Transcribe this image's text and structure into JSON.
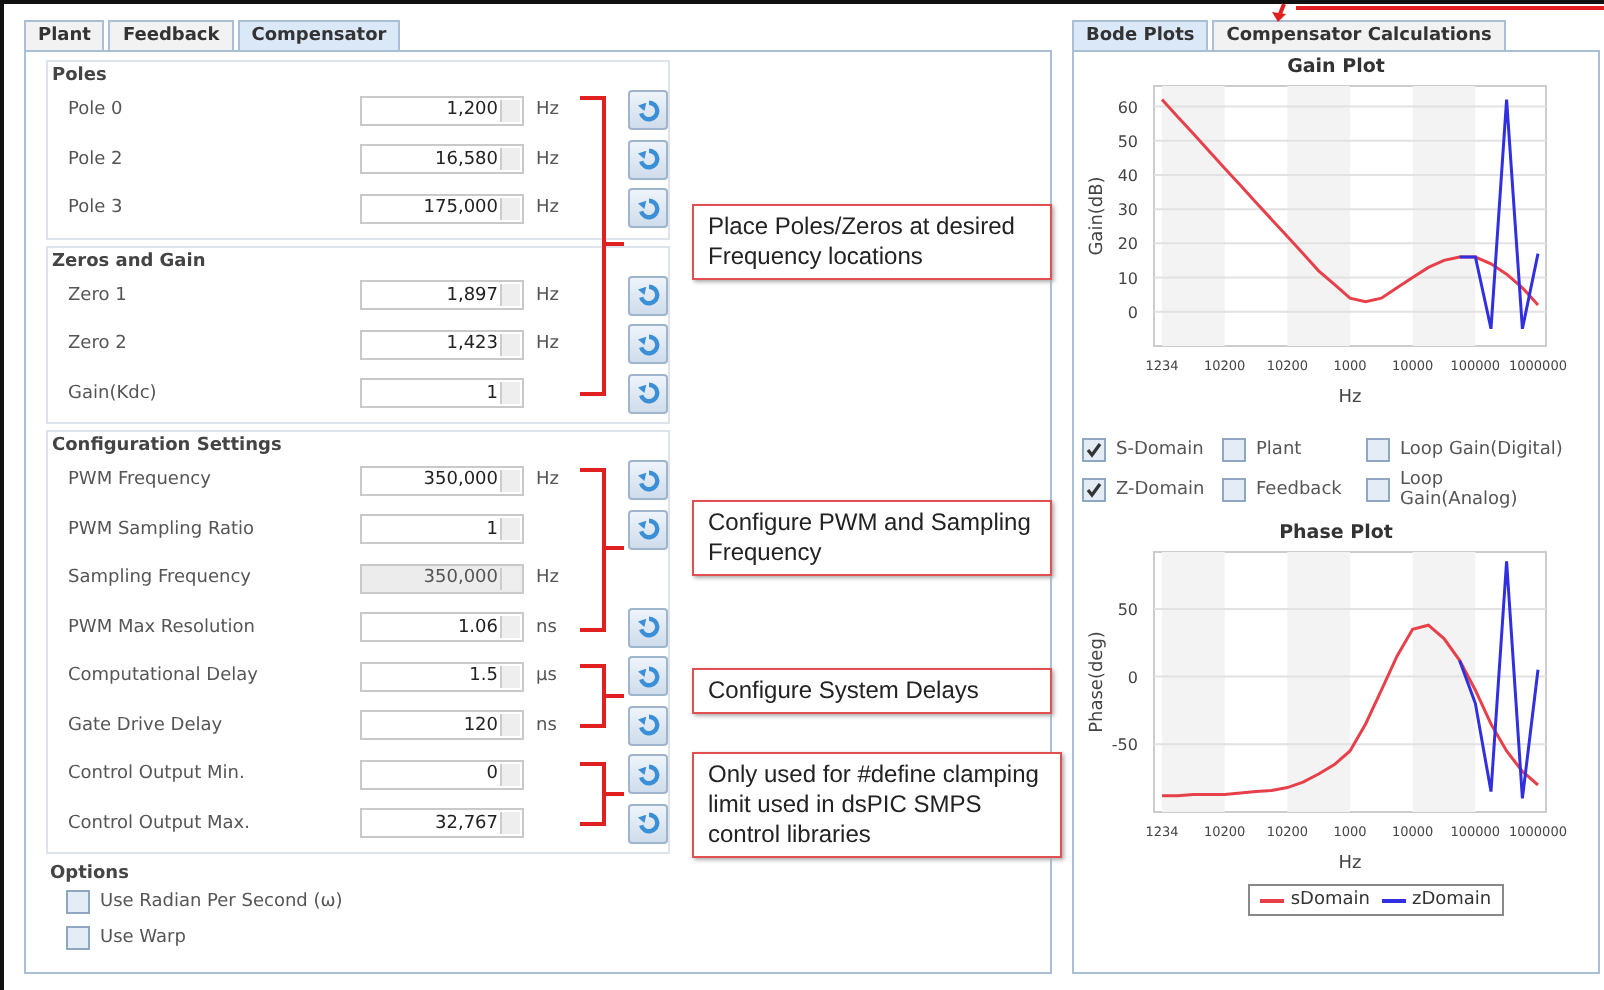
{
  "left_tabs": [
    {
      "label": "Plant",
      "selected": false
    },
    {
      "label": "Feedback",
      "selected": false
    },
    {
      "label": "Compensator",
      "selected": true
    }
  ],
  "groups": [
    {
      "title": "Poles",
      "rows": [
        {
          "label": "Pole 0",
          "value": "1,200",
          "unit": "Hz",
          "disabled": false,
          "reset_button": true
        },
        {
          "label": "Pole 2",
          "value": "16,580",
          "unit": "Hz",
          "disabled": false,
          "reset_button": true
        },
        {
          "label": "Pole 3",
          "value": "175,000",
          "unit": "Hz",
          "disabled": false,
          "reset_button": true
        }
      ]
    },
    {
      "title": "Zeros and Gain",
      "rows": [
        {
          "label": "Zero 1",
          "value": "1,897",
          "unit": "Hz",
          "disabled": false,
          "reset_button": true
        },
        {
          "label": "Zero 2",
          "value": "1,423",
          "unit": "Hz",
          "disabled": false,
          "reset_button": true
        },
        {
          "label": "Gain(Kdc)",
          "value": "1",
          "disabled": false,
          "reset_button": true
        }
      ]
    },
    {
      "title": "Configuration Settings",
      "rows": [
        {
          "label": "PWM Frequency",
          "value": "350,000",
          "unit": "Hz",
          "disabled": false,
          "reset_button": true
        },
        {
          "label": "PWM Sampling Ratio",
          "value": "1",
          "disabled": false,
          "reset_button": true
        },
        {
          "label": "Sampling Frequency",
          "value": "350,000",
          "unit": "Hz",
          "disabled": true,
          "reset_button": false
        },
        {
          "label": "PWM Max Resolution",
          "value": "1.06",
          "unit": "ns",
          "disabled": false,
          "reset_button": true
        },
        {
          "label": "Computational Delay",
          "value": "1.5",
          "unit": "µs",
          "disabled": false,
          "reset_button": true
        },
        {
          "label": "Gate Drive Delay",
          "value": "120",
          "unit": "ns",
          "disabled": false,
          "reset_button": true
        },
        {
          "label": "Control Output Min.",
          "value": "0",
          "disabled": false,
          "reset_button": true
        },
        {
          "label": "Control Output Max.",
          "value": "32,767",
          "disabled": false,
          "reset_button": true
        }
      ]
    }
  ],
  "options": {
    "title": "Options",
    "items": [
      {
        "label": "Use Radian Per Second (ω)",
        "checked": false
      },
      {
        "label": "Use Warp",
        "checked": false
      }
    ]
  },
  "callouts": [
    "Place Poles/Zeros at desired Frequency locations",
    "Configure PWM and Sampling Frequency",
    "Configure System Delays",
    "Only used for #define clamping limit used in dsPIC SMPS control libraries"
  ],
  "right_tabs": [
    {
      "label": "Bode Plots",
      "selected": true
    },
    {
      "label": "Compensator Calculations",
      "selected": false
    }
  ],
  "gain_plot": {
    "chart_data": {
      "type": "line",
      "title": "Gain Plot",
      "xlabel": "Hz",
      "ylabel": "Gain(dB)",
      "categories": [
        "1234",
        null,
        null,
        null,
        "10200",
        null,
        null,
        null,
        "10200",
        null,
        null,
        null,
        "1000",
        null,
        null,
        null,
        "10000",
        null,
        null,
        null,
        "100000",
        null,
        null,
        null,
        "1000000"
      ],
      "series": [
        {
          "color": "#e8404a",
          "values": [
            62,
            57,
            52,
            47,
            42,
            37,
            32,
            27,
            22,
            17,
            12,
            8,
            4,
            3,
            4,
            7,
            10,
            13,
            15,
            16,
            16,
            14,
            11,
            7,
            2
          ]
        },
        {
          "color": "#3030e0",
          "values": [
            null,
            null,
            null,
            null,
            null,
            null,
            null,
            null,
            null,
            null,
            null,
            null,
            null,
            null,
            null,
            null,
            null,
            null,
            null,
            16,
            16,
            -5,
            62,
            -5,
            17
          ]
        }
      ],
      "grid": true,
      "ylim": [
        -10,
        66
      ],
      "yticks": [
        0,
        10,
        20,
        30,
        40,
        50,
        60
      ]
    }
  },
  "series_toggles": [
    {
      "label": "S-Domain",
      "checked": true
    },
    {
      "label": "Plant",
      "checked": false
    },
    {
      "label": "Loop Gain(Digital)",
      "checked": false
    },
    {
      "label": "Z-Domain",
      "checked": true
    },
    {
      "label": "Feedback",
      "checked": false
    },
    {
      "label": "Loop Gain(Analog)",
      "checked": false
    }
  ],
  "phase_plot": {
    "chart_data": {
      "type": "line",
      "title": "Phase Plot",
      "xlabel": "Hz",
      "ylabel": "Phase(deg)",
      "categories": [
        "1234",
        null,
        null,
        null,
        "10200",
        null,
        null,
        null,
        "10200",
        null,
        null,
        null,
        "1000",
        null,
        null,
        null,
        "10000",
        null,
        null,
        null,
        "100000",
        null,
        null,
        null,
        "1000000"
      ],
      "series": [
        {
          "name": "sDomain",
          "color": "#e8404a",
          "values": [
            -88,
            -88,
            -87,
            -87,
            -87,
            -86,
            -85,
            -84,
            -82,
            -78,
            -72,
            -65,
            -55,
            -35,
            -10,
            15,
            35,
            38,
            28,
            12,
            -10,
            -35,
            -55,
            -70,
            -80
          ]
        },
        {
          "name": "zDomain",
          "color": "#3030e0",
          "values": [
            null,
            null,
            null,
            null,
            null,
            null,
            null,
            null,
            null,
            null,
            null,
            null,
            null,
            null,
            null,
            null,
            null,
            null,
            null,
            12,
            -20,
            -85,
            85,
            -90,
            5
          ]
        }
      ],
      "grid": true,
      "ylim": [
        -100,
        92
      ],
      "yticks": [
        -50,
        0,
        50
      ]
    },
    "legend": true
  }
}
